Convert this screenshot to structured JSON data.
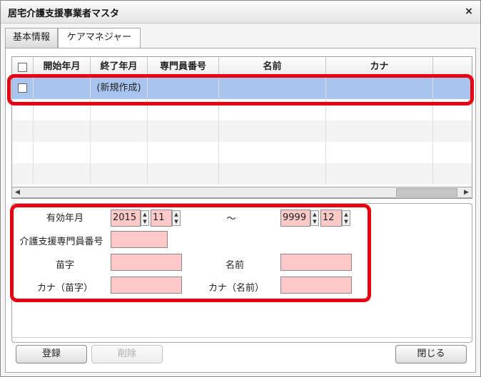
{
  "window": {
    "title": "居宅介護支援事業者マスタ",
    "close_glyph": "×"
  },
  "tabs": [
    {
      "label": "基本情報",
      "active": false
    },
    {
      "label": "ケアマネジャー",
      "active": true
    }
  ],
  "grid": {
    "columns": [
      "開始年月",
      "終了年月",
      "専門員番号",
      "名前",
      "カナ"
    ],
    "rows": [
      {
        "checked": false,
        "start": "",
        "end": "(新規作成)",
        "number": "",
        "name": "",
        "kana": "",
        "selected": true
      }
    ],
    "scroll_left": "◀",
    "scroll_right": "▶"
  },
  "form": {
    "valid_period_label": "有効年月",
    "start_year": "2015",
    "start_month": "11",
    "tilde": "～",
    "end_year": "9999",
    "end_month": "12",
    "specialist_number_label": "介護支援専門員番号",
    "specialist_number": "",
    "surname_label": "苗字",
    "surname": "",
    "given_name_label": "名前",
    "given_name": "",
    "surname_kana_label": "カナ（苗字）",
    "surname_kana": "",
    "given_name_kana_label": "カナ（名前）",
    "given_name_kana": "",
    "spin_up": "▲",
    "spin_down": "▼"
  },
  "buttons": {
    "register": "登録",
    "delete": "削除",
    "close": "閉じる"
  },
  "colors": {
    "highlight": "#e60012",
    "selected_row": "#a9c5ef",
    "required_field": "#ffc9c9"
  }
}
